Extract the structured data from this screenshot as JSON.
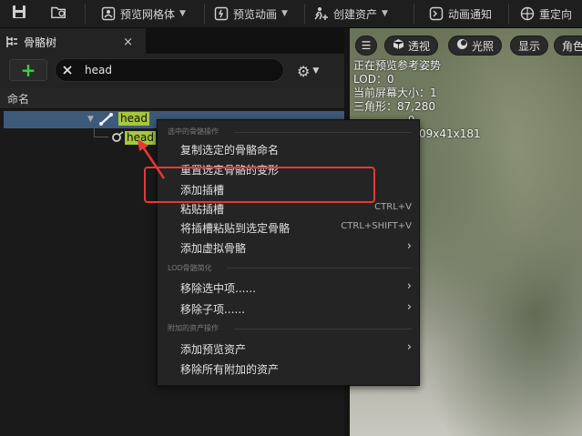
{
  "toolbar": {
    "items": [
      {
        "label": "预览网格体",
        "icon": "mesh-icon"
      },
      {
        "label": "预览动画",
        "icon": "animation-icon"
      },
      {
        "label": "创建资产",
        "icon": "create-asset-icon"
      },
      {
        "label": "动画通知",
        "icon": "anim-notify-icon"
      },
      {
        "label": "重定向",
        "icon": "retarget-icon"
      }
    ]
  },
  "skeleton_panel": {
    "tab_title": "骨骼树",
    "close_label": "×",
    "search_value": "head",
    "column_header": "命名",
    "tree": [
      {
        "name": "head",
        "type": "bone",
        "selected": true
      },
      {
        "name": "head",
        "type": "socket"
      }
    ]
  },
  "viewport": {
    "buttons": {
      "perspective": "透视",
      "lighting": "光照",
      "show": "显示",
      "character": "角色"
    },
    "stats": {
      "line1": "正在预览参考姿势",
      "line2": "LOD：0",
      "line3": "当前屏幕大小：1",
      "line4": "三角形：87,280",
      "line5": "9",
      "line6": "09x41x181"
    }
  },
  "context_menu": {
    "section1": "选中的骨骼操作",
    "copy_name": "复制选定的骨骼命名",
    "reset_transform": "重置选定骨骼的变形",
    "add_socket": "添加插槽",
    "paste_socket": "粘贴插槽",
    "paste_socket_shortcut": "CTRL+V",
    "paste_to_bone": "将插槽粘贴到选定骨骼",
    "paste_to_bone_shortcut": "CTRL+SHIFT+V",
    "add_virtual_bone": "添加虚拟骨骼",
    "section2": "LOD骨骼简化",
    "remove_selected": "移除选中项......",
    "remove_children": "移除子项......",
    "section3": "附加的资产操作",
    "add_preview_asset": "添加预览资产",
    "remove_all_attached": "移除所有附加的资产"
  },
  "colors": {
    "highlight_box": "#e53935",
    "search_highlight": "#a7c73e",
    "selection": "#3e5a7a",
    "add_button": "#3ed13e"
  }
}
